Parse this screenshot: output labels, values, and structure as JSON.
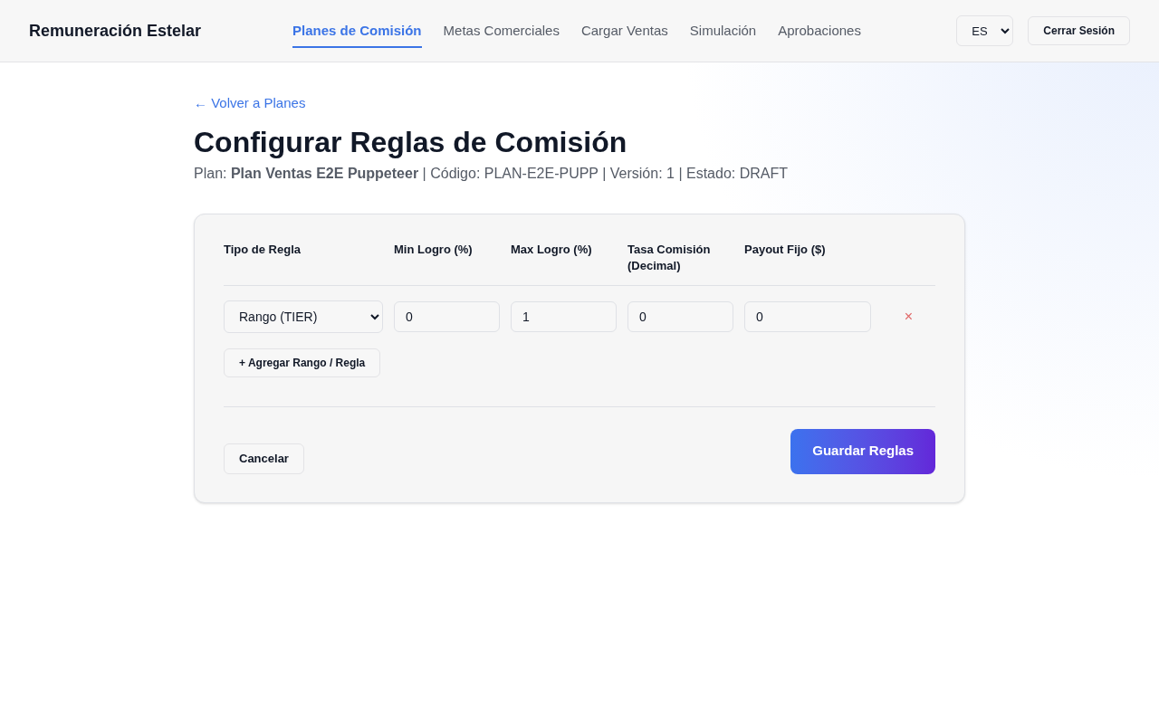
{
  "header": {
    "brand": "Remuneración Estelar",
    "nav": [
      {
        "label": "Planes de Comisión",
        "selected": true
      },
      {
        "label": "Metas Comerciales",
        "selected": false
      },
      {
        "label": "Cargar Ventas",
        "selected": false
      },
      {
        "label": "Simulación",
        "selected": false
      },
      {
        "label": "Aprobaciones",
        "selected": false
      }
    ],
    "language": "ES",
    "logout": "Cerrar Sesión"
  },
  "back_link": "← Volver a Planes",
  "title": "Configurar Reglas de Comisión",
  "subtitle": "Plan: **Plan Ventas E2E Puppeteer** | Código: PLAN-E2E-PUPP | Versión: 1 | Estado: DRAFT",
  "table": {
    "columns": [
      "Tipo de Regla",
      "Min Logro (%)",
      "Max Logro (%)",
      "Tasa Comisión (Decimal)",
      "Payout Fijo ($)"
    ],
    "rows": [
      {
        "type": "Rango (TIER)",
        "min": "0",
        "max": "1",
        "rate": "0",
        "payout": "0",
        "remove": "×"
      }
    ]
  },
  "add_button": "+ Agregar Rango / Regla",
  "cancel_button": "Cancelar",
  "save_button": "Guardar Reglas"
}
